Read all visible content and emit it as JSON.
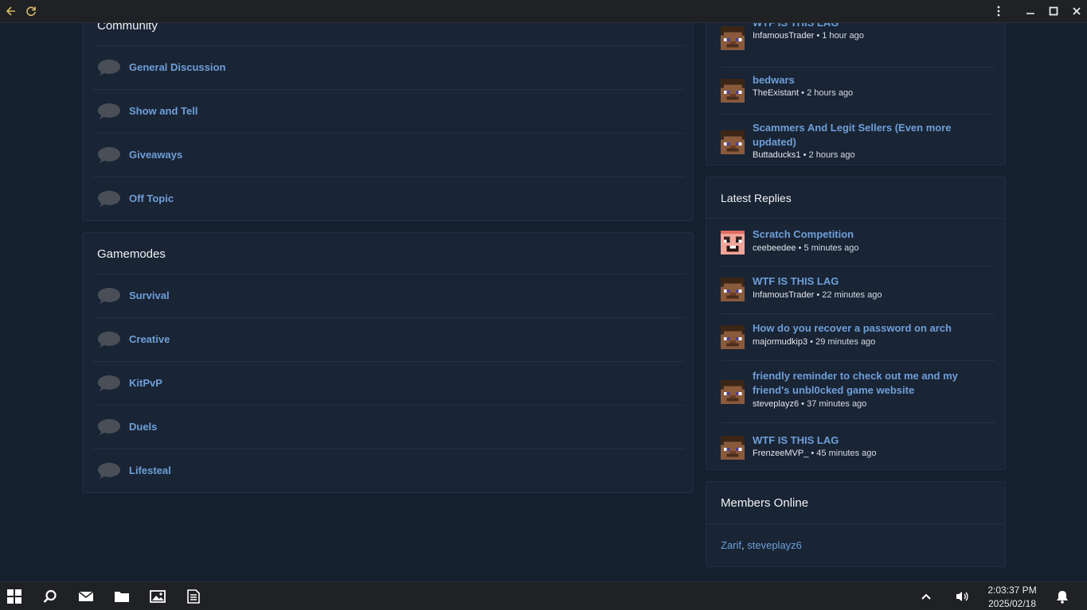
{
  "browser": {
    "back_icon": "arrow-left-icon",
    "reload_icon": "reload-icon",
    "menu_icon": "more-vertical-icon",
    "minimize_icon": "minimize-icon",
    "maximize_icon": "maximize-icon",
    "close_icon": "close-icon"
  },
  "community": {
    "title": "Community",
    "forums": [
      {
        "label": "General Discussion"
      },
      {
        "label": "Show and Tell"
      },
      {
        "label": "Giveaways"
      },
      {
        "label": "Off Topic"
      }
    ]
  },
  "gamemodes": {
    "title": "Gamemodes",
    "forums": [
      {
        "label": "Survival"
      },
      {
        "label": "Creative"
      },
      {
        "label": "KitPvP"
      },
      {
        "label": "Duels"
      },
      {
        "label": "Lifesteal"
      }
    ]
  },
  "latest_threads": {
    "items": [
      {
        "title": "WTF IS THIS LAG",
        "user": "InfamousTrader",
        "time": "1 hour ago"
      },
      {
        "title": "bedwars",
        "user": "TheExistant",
        "time": "2 hours ago"
      },
      {
        "title": "Scammers And Legit Sellers (Even more updated)",
        "user": "Buttaducks1",
        "time": "2 hours ago"
      }
    ]
  },
  "latest_replies": {
    "title": "Latest Replies",
    "items": [
      {
        "title": "Scratch Competition",
        "user": "ceebeedee",
        "time": "5 minutes ago"
      },
      {
        "title": "WTF IS THIS LAG",
        "user": "InfamousTrader",
        "time": "22 minutes ago"
      },
      {
        "title": "How do you recover a password on arch",
        "user": "majormudkip3",
        "time": "29 minutes ago"
      },
      {
        "title": "friendly reminder to check out me and my friend's unbl0cked game website",
        "user": "steveplayz6",
        "time": "37 minutes ago"
      },
      {
        "title": "WTF IS THIS LAG",
        "user": "FrenzeeMVP_",
        "time": "45 minutes ago"
      }
    ]
  },
  "members_online": {
    "title": "Members Online",
    "members": [
      "Zarif",
      "steveplayz6"
    ],
    "separator": ","
  },
  "meta_separator": "•",
  "taskbar": {
    "time": "2:03:37 PM",
    "date": "2025/02/18"
  },
  "colors": {
    "background": "#15202f",
    "panel": "#192435",
    "link": "#6f9fd8",
    "taskbar": "#202124"
  }
}
